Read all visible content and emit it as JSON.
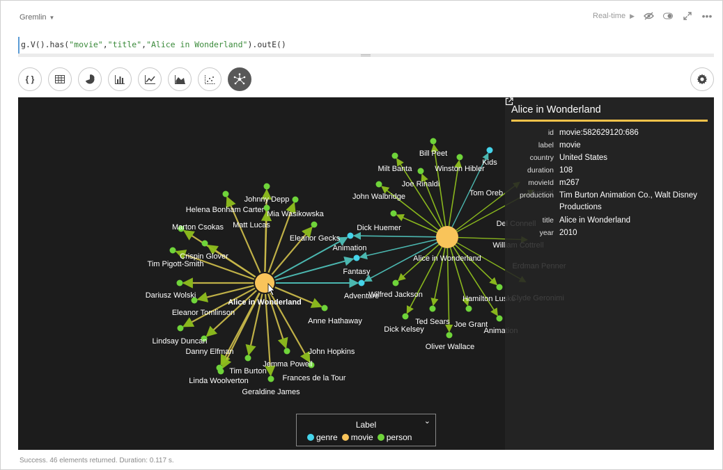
{
  "toolbar": {
    "language": "Gremlin",
    "realtime_label": "Real-time"
  },
  "query": {
    "prefix": "g.V().has(",
    "arg1": "\"movie\"",
    "sep1": ",",
    "arg2": "\"title\"",
    "sep2": ",",
    "arg3": "\"Alice in Wonderland\"",
    "suffix": ").outE()"
  },
  "view_buttons": [
    {
      "name": "json-view",
      "icon": "braces-icon",
      "glyph": "{ }"
    },
    {
      "name": "table-view",
      "icon": "table-icon"
    },
    {
      "name": "pie-view",
      "icon": "pie-chart-icon"
    },
    {
      "name": "bar-view",
      "icon": "bar-chart-icon"
    },
    {
      "name": "line-view",
      "icon": "line-chart-icon"
    },
    {
      "name": "area-view",
      "icon": "area-chart-icon"
    },
    {
      "name": "scatter-view",
      "icon": "scatter-chart-icon"
    },
    {
      "name": "graph-view",
      "icon": "graph-network-icon",
      "active": true
    }
  ],
  "colors": {
    "genre": "#45d4ea",
    "movie": "#f9c45a",
    "person": "#6fd43a",
    "edge_person": "#8fbf1e",
    "edge_genre": "#4ec0b8",
    "edge_movie_tint": "#c8b84a",
    "panel_accent": "#f5c24a"
  },
  "graph": {
    "center_labels": {
      "primary": "Alice in Wonderland",
      "secondary": "Alice in Wonderland"
    },
    "genres": [
      "Animation",
      "Fantasy",
      "Adventure"
    ],
    "primary_people": [
      "Johnny Depp",
      "Helena Bonham Carter",
      "Mia Wasikowska",
      "Matt Lucas",
      "Marton Csokas",
      "Eleanor Gecks",
      "Crispin Glover",
      "Tim Pigott-Smith",
      "Dariusz Wolski",
      "Eleanor Tomlinson",
      "Anne Hathaway",
      "Lindsay Duncan",
      "Danny Elfman",
      "John Hopkins",
      "Jemma Powell",
      "Tim Burton",
      "Frances de la Tour",
      "Linda Woolverton",
      "Geraldine James"
    ],
    "secondary_people": [
      "Bill Peet",
      "Milt Banta",
      "Winston Hibler",
      "Joe Rinaldi",
      "John Walbridge",
      "Dick Huemer",
      "Wilfred Jackson",
      "Ted Sears",
      "Joe Grant",
      "Dick Kelsey",
      "Oliver Wallace",
      "Hamilton Luske",
      "Animation"
    ],
    "secondary_genre": [
      "Kids"
    ],
    "faded_labels": [
      "Tom Oreb",
      "Musical",
      "Del Connell",
      "William Cottrell",
      "Erdman Penner",
      "Clyde Geronimi"
    ]
  },
  "legend": {
    "title": "Label",
    "items": [
      {
        "label": "genre",
        "color": "#45d4ea"
      },
      {
        "label": "movie",
        "color": "#f9c45a"
      },
      {
        "label": "person",
        "color": "#6fd43a"
      }
    ]
  },
  "details": {
    "title": "Alice in Wonderland",
    "props": [
      {
        "key": "id",
        "value": "movie:582629120:686"
      },
      {
        "key": "label",
        "value": "movie"
      },
      {
        "key": "country",
        "value": "United States"
      },
      {
        "key": "duration",
        "value": "108"
      },
      {
        "key": "movieId",
        "value": "m267"
      },
      {
        "key": "production",
        "value": "Tim Burton Animation Co., Walt Disney Productions"
      },
      {
        "key": "title",
        "value": "Alice in Wonderland"
      },
      {
        "key": "year",
        "value": "2010"
      }
    ]
  },
  "status": "Success. 46 elements returned. Duration: 0.117 s."
}
